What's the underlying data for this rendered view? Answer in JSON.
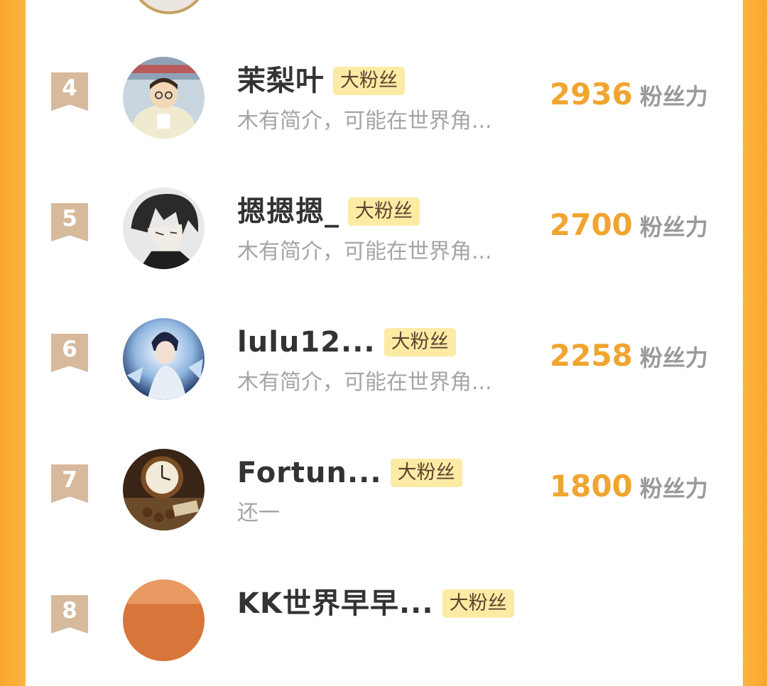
{
  "leaderboard": {
    "rows": [
      {
        "rank": "4",
        "name": "茉梨叶",
        "badge": "大粉丝",
        "bio": "木有简介，可能在世界角...",
        "score": "2936",
        "unit": "粉丝力"
      },
      {
        "rank": "5",
        "name": "摁摁摁_",
        "badge": "大粉丝",
        "bio": "木有简介，可能在世界角...",
        "score": "2700",
        "unit": "粉丝力"
      },
      {
        "rank": "6",
        "name": "lulu12...",
        "badge": "大粉丝",
        "bio": "木有简介，可能在世界角...",
        "score": "2258",
        "unit": "粉丝力"
      },
      {
        "rank": "7",
        "name": "Fortun...",
        "badge": "大粉丝",
        "bio": "还一",
        "score": "1800",
        "unit": "粉丝力"
      },
      {
        "rank": "8",
        "name": "KK世界早早...",
        "badge": "大粉丝",
        "bio": "",
        "score": "",
        "unit": ""
      }
    ]
  },
  "colors": {
    "frame_orange": "#f9a72c",
    "score_orange": "#f0a530",
    "badge_yellow": "#fbeba4",
    "rank_badge": "#d7b99b"
  }
}
